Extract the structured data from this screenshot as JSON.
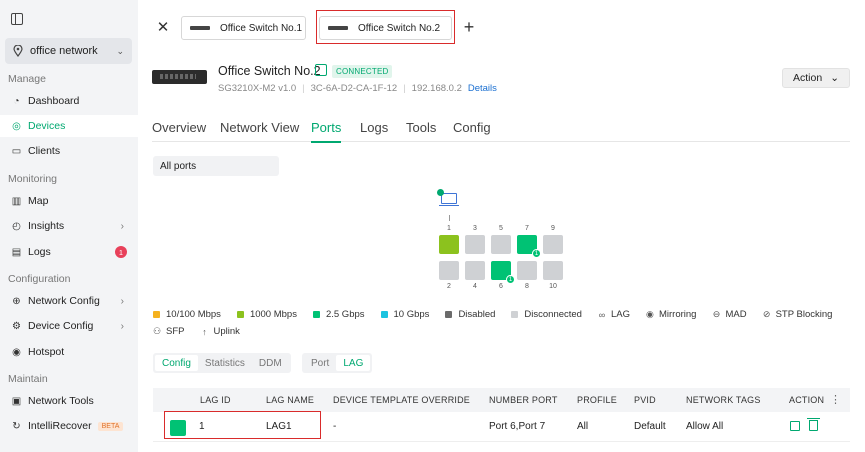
{
  "sidebar": {
    "site": "office network",
    "sections": {
      "manage": "Manage",
      "monitoring": "Monitoring",
      "configuration": "Configuration",
      "maintain": "Maintain"
    },
    "items": [
      {
        "label": "Dashboard",
        "icon": "speedometer-icon"
      },
      {
        "label": "Devices",
        "icon": "devices-icon",
        "active": true
      },
      {
        "label": "Clients",
        "icon": "clients-icon"
      },
      {
        "label": "Map",
        "icon": "map-icon"
      },
      {
        "label": "Insights",
        "icon": "insights-icon"
      },
      {
        "label": "Logs",
        "icon": "logs-icon",
        "badge": "1"
      },
      {
        "label": "Network Config",
        "icon": "globe-icon"
      },
      {
        "label": "Device Config",
        "icon": "gear-icon"
      },
      {
        "label": "Hotspot",
        "icon": "hotspot-icon"
      },
      {
        "label": "Network Tools",
        "icon": "toolbox-icon"
      },
      {
        "label": "IntelliRecover",
        "icon": "recover-icon",
        "tag": "BETA"
      }
    ]
  },
  "tabs": {
    "tab1": "Office Switch No.1",
    "tab2": "Office Switch No.2"
  },
  "device": {
    "name": "Office Switch No.2",
    "status": "CONNECTED",
    "model": "SG3210X-M2 v1.0",
    "mac": "3C-6A-D2-CA-1F-12",
    "ip": "192.168.0.2",
    "details_link": "Details",
    "action_label": "Action"
  },
  "page_tabs": [
    "Overview",
    "Network View",
    "Ports",
    "Logs",
    "Tools",
    "Config"
  ],
  "active_page_tab": "Ports",
  "ports_filter": "All ports",
  "ports": {
    "top_numbers": [
      "1",
      "3",
      "5",
      "7",
      "9"
    ],
    "bottom_numbers": [
      "2",
      "4",
      "6",
      "8",
      "10"
    ],
    "lag_marker": "1"
  },
  "legend": [
    {
      "label": "10/100 Mbps",
      "color": "#f5b21f"
    },
    {
      "label": "1000 Mbps",
      "color": "#8cc21e"
    },
    {
      "label": "2.5 Gbps",
      "color": "#00c274"
    },
    {
      "label": "10 Gbps",
      "color": "#1cc3e0"
    },
    {
      "label": "Disabled",
      "color": "#6b6b6b"
    },
    {
      "label": "Disconnected",
      "color": "#cfd1d4"
    },
    {
      "label": "LAG",
      "symbol": "∞"
    },
    {
      "label": "Mirroring",
      "symbol": "◉"
    },
    {
      "label": "MAD",
      "symbol": "⊖"
    },
    {
      "label": "STP Blocking",
      "symbol": "⊘"
    },
    {
      "label": "SFP",
      "symbol": "⚇"
    },
    {
      "label": "Uplink",
      "symbol": "↑"
    }
  ],
  "sub_tabs": [
    "Config",
    "Statistics",
    "DDM"
  ],
  "view_tabs": [
    "Port",
    "LAG"
  ],
  "table": {
    "headers": [
      "LAG ID",
      "LAG NAME",
      "DEVICE TEMPLATE OVERRIDE",
      "NUMBER PORT",
      "PROFILE",
      "PVID",
      "NETWORK TAGS",
      "ACTION"
    ],
    "rows": [
      {
        "lag_id": "1",
        "lag_name": "LAG1",
        "override": "-",
        "ports": "Port 6,Port 7",
        "profile": "All",
        "pvid": "Default",
        "tags": "Allow All"
      }
    ]
  }
}
